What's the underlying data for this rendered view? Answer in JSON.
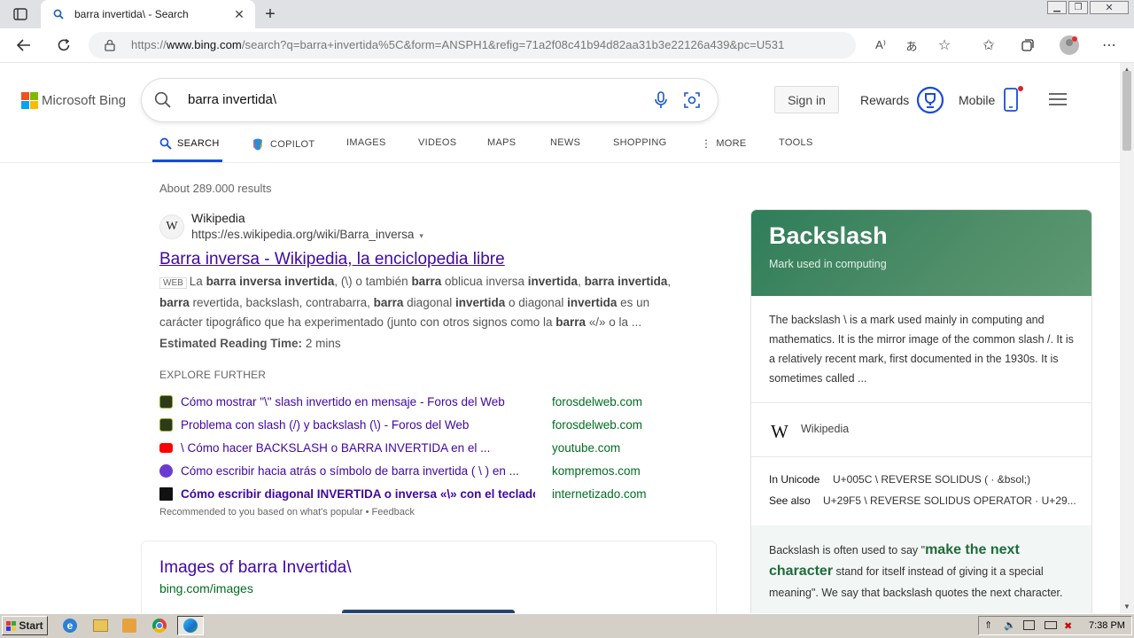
{
  "browser": {
    "tab_title": "barra invertida\\ - Search",
    "url_prefix": "https://",
    "url_domain": "www.bing.com",
    "url_rest": "/search?q=barra+invertida%5C&form=ANSPH1&refig=71a2f08c41b94d82aa31b3e22126a439&pc=U531"
  },
  "bing": {
    "logo_text": "Microsoft Bing",
    "query": "barra invertida\\",
    "signin_label": "Sign in",
    "rewards_label": "Rewards",
    "mobile_label": "Mobile",
    "scopes": [
      "SEARCH",
      "COPILOT",
      "IMAGES",
      "VIDEOS",
      "MAPS",
      "NEWS",
      "SHOPPING",
      "MORE",
      "TOOLS"
    ]
  },
  "results": {
    "count": "About 289.000 results",
    "first": {
      "site": "Wikipedia",
      "cite": "https://es.wikipedia.org/wiki/Barra_inversa",
      "title": "Barra inversa - Wikipedia, la enciclopedia libre",
      "badge": "WEB",
      "reading_label": "Estimated Reading Time:",
      "reading_value": "2 mins"
    },
    "explore_heading": "EXPLORE FURTHER",
    "explore": [
      {
        "text": "Cómo mostrar \"\\\" slash invertido en mensaje - Foros del Web",
        "domain": "forosdelweb.com"
      },
      {
        "text": "Problema con slash (/) y backslash (\\) - Foros del Web",
        "domain": "forosdelweb.com"
      },
      {
        "text": "\\ Cómo hacer BACKSLASH o BARRA INVERTIDA en el ...",
        "domain": "youtube.com"
      },
      {
        "text": "Cómo escribir hacia atrás o símbolo de barra invertida ( \\ ) en ...",
        "domain": "kompremos.com"
      },
      {
        "text": "Cómo escribir diagonal INVERTIDA o inversa «\\» con el teclado",
        "domain": "internetizado.com"
      }
    ],
    "recommended": "Recommended to you based on what's popular • Feedback",
    "images_title": "Images of barra Invertida\\",
    "images_cite": "bing.com/images"
  },
  "knowledge": {
    "title": "Backslash",
    "subtitle": "Mark used in computing",
    "description": "The backslash \\ is a mark used mainly in computing and mathematics. It is the mirror image of the common slash /. It is a relatively recent mark, first documented in the 1930s. It is sometimes called ...",
    "source": "Wikipedia",
    "unicode_label": "In Unicode",
    "unicode_value": "U+005C \\ REVERSE SOLIDUS ( · &bsol;)",
    "seealso_label": "See also",
    "seealso_value": "U+29F5 \\ REVERSE SOLIDUS OPERATOR · U+29...",
    "tip_pre": "Backslash is often used to say \"",
    "tip_bold": "make the next character",
    "tip_post": " stand for itself instead of giving it a special meaning\". We say that backslash quotes the next character."
  },
  "taskbar": {
    "start_label": "Start",
    "clock": "7:38 PM"
  }
}
